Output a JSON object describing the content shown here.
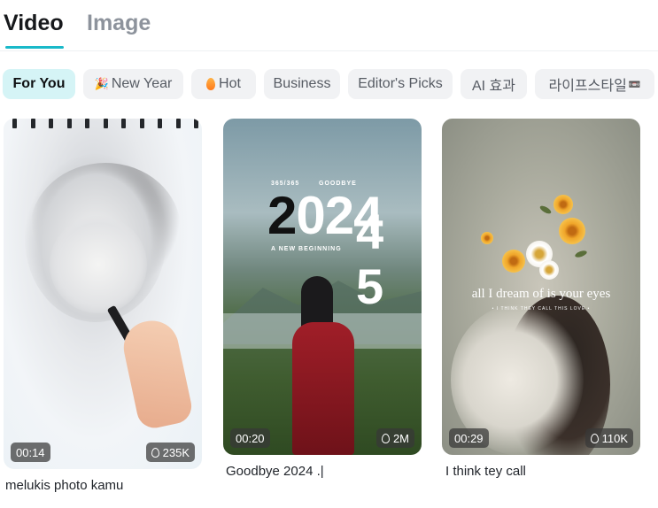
{
  "top_tabs": {
    "video": "Video",
    "image": "Image",
    "active": "Video"
  },
  "accent_color": "#19b9c9",
  "chips": [
    {
      "label": "For You",
      "icon": null,
      "active": true
    },
    {
      "label": "New Year",
      "icon": "party-popper-icon",
      "active": false
    },
    {
      "label": "Hot",
      "icon": "flame-icon",
      "active": false
    },
    {
      "label": "Business",
      "icon": null,
      "active": false
    },
    {
      "label": "Editor's Picks",
      "icon": null,
      "active": false
    },
    {
      "label": "AI 효과",
      "icon": null,
      "active": false
    },
    {
      "label": "라이프스타일",
      "icon": "video-tape-icon",
      "active": false
    }
  ],
  "cards": [
    {
      "duration": "00:14",
      "uses": "235K",
      "caption": "melukis photo kamu"
    },
    {
      "duration": "00:20",
      "uses": "2M",
      "caption": "Goodbye 2024 .|",
      "overlay": {
        "top_left": "365/365",
        "top_right": "GOODBYE",
        "year": "2024",
        "year_first_digit": "2",
        "year_rest": "024",
        "subtitle": "A NEW BEGINNING",
        "new_digit_1": "4",
        "new_digit_2": "5"
      }
    },
    {
      "duration": "00:29",
      "uses": "110K",
      "caption": "I think tey call",
      "overlay": {
        "title": "all I dream of is your eyes",
        "subtitle": "• I THINK THEY CALL THIS LOVE •"
      }
    }
  ]
}
